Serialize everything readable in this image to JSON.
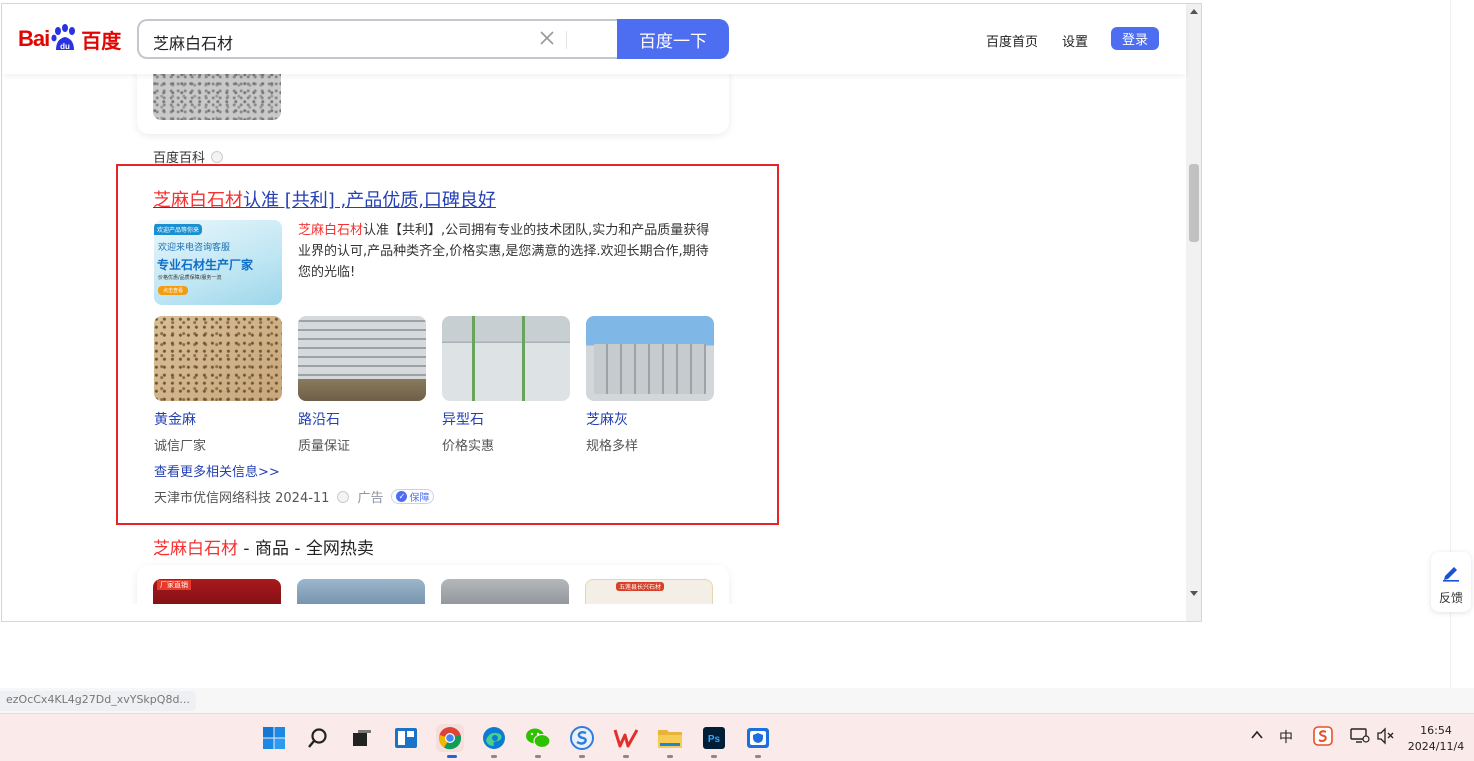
{
  "header": {
    "logo_text_left": "Bai",
    "logo_text_paw": "du",
    "logo_text_cn": "百度",
    "search_value": "芝麻白石材",
    "search_button": "百度一下",
    "nav_home": "百度首页",
    "nav_settings": "设置",
    "login": "登录"
  },
  "prev_result": {
    "source": "百度百科"
  },
  "ad": {
    "title_highlight": "芝麻白石材",
    "title_rest": "认准 [共利] ,产品优质,口碑良好",
    "banner": {
      "tag": "欢迎产品等你来",
      "line1": "欢迎来电咨询客服",
      "line2": "专业石材生产厂家",
      "line3": "价格优惠/品质保障/服务一流",
      "cta": "点击查看"
    },
    "desc_highlight": "芝麻白石材",
    "desc_rest": "认准【共利】,公司拥有专业的技术团队,实力和产品质量获得业界的认可,产品种类齐全,价格实惠,是您满意的选择.欢迎长期合作,期待您的光临!",
    "products": [
      {
        "name": "黄金麻",
        "sub": "诚信厂家",
        "highlight": false
      },
      {
        "name": "路沿石",
        "sub": "质量保证",
        "highlight": false
      },
      {
        "name": "异型石",
        "sub": "价格实惠",
        "highlight": false
      },
      {
        "name": "芝麻灰",
        "sub": "规格多样",
        "highlight": true
      }
    ],
    "more": "查看更多相关信息>>",
    "advertiser": "天津市优信网络科技 2024-11",
    "ad_label": "广告",
    "guarantee": "保障"
  },
  "next_result": {
    "title_highlight": "芝麻白石材",
    "title_rest": " - 商品 - 全网热卖",
    "thumb1_tag": "厂家直销",
    "thumb4_tag": "五莲县长兴石材"
  },
  "feedback": {
    "label": "反馈"
  },
  "status_url": "ezOcCx4KL4g27Dd_xvYSkpQ8d...",
  "taskbar": {
    "tray_ime": "中",
    "clock_time": "16:54",
    "clock_date": "2024/11/4"
  },
  "colors": {
    "accent": "#4e6ef2",
    "highlight_red": "#f73131",
    "link_blue": "#2440b3",
    "frame_red": "#e4252a"
  }
}
